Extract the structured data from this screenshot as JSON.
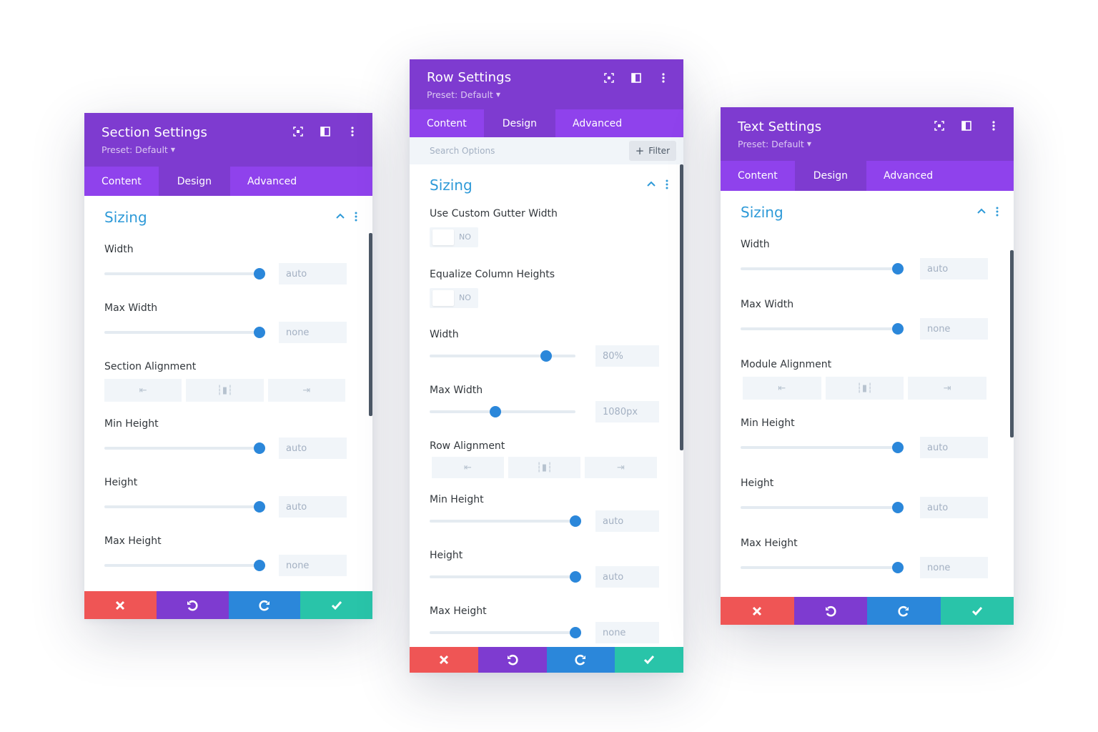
{
  "colors": {
    "header": "#7e3bd0",
    "tabs": "#8f42ec",
    "accent_blue": "#2b87da",
    "group_title": "#2e9ad8",
    "cancel": "#ef5555",
    "redo": "#2b87da",
    "save": "#29c4a9"
  },
  "tabs": {
    "content": "Content",
    "design": "Design",
    "advanced": "Advanced"
  },
  "section": {
    "title": "Section Settings",
    "preset": "Preset: Default",
    "group": "Sizing",
    "width": {
      "label": "Width",
      "value": "auto",
      "slider": 1.0
    },
    "max_width": {
      "label": "Max Width",
      "value": "none",
      "slider": 1.0
    },
    "alignment": {
      "label": "Section Alignment"
    },
    "min_height": {
      "label": "Min Height",
      "value": "auto",
      "slider": 1.0
    },
    "height": {
      "label": "Height",
      "value": "auto",
      "slider": 1.0
    },
    "max_height": {
      "label": "Max Height",
      "value": "none",
      "slider": 1.0
    }
  },
  "row": {
    "title": "Row Settings",
    "preset": "Preset: Default",
    "search_placeholder": "Search Options",
    "filter_label": "Filter",
    "group": "Sizing",
    "gutter": {
      "label": "Use Custom Gutter Width",
      "state": "NO"
    },
    "equalize": {
      "label": "Equalize Column Heights",
      "state": "NO"
    },
    "width": {
      "label": "Width",
      "value": "80%",
      "slider": 0.8
    },
    "max_width": {
      "label": "Max Width",
      "value": "1080px",
      "slider": 0.45
    },
    "alignment": {
      "label": "Row Alignment"
    },
    "min_height": {
      "label": "Min Height",
      "value": "auto",
      "slider": 1.0
    },
    "height": {
      "label": "Height",
      "value": "auto",
      "slider": 1.0
    },
    "max_height": {
      "label": "Max Height",
      "value": "none",
      "slider": 1.0
    }
  },
  "text": {
    "title": "Text Settings",
    "preset": "Preset: Default",
    "group": "Sizing",
    "width": {
      "label": "Width",
      "value": "auto",
      "slider": 1.0
    },
    "max_width": {
      "label": "Max Width",
      "value": "none",
      "slider": 1.0
    },
    "alignment": {
      "label": "Module Alignment"
    },
    "min_height": {
      "label": "Min Height",
      "value": "auto",
      "slider": 1.0
    },
    "height": {
      "label": "Height",
      "value": "auto",
      "slider": 1.0
    },
    "max_height": {
      "label": "Max Height",
      "value": "none",
      "slider": 1.0
    }
  }
}
